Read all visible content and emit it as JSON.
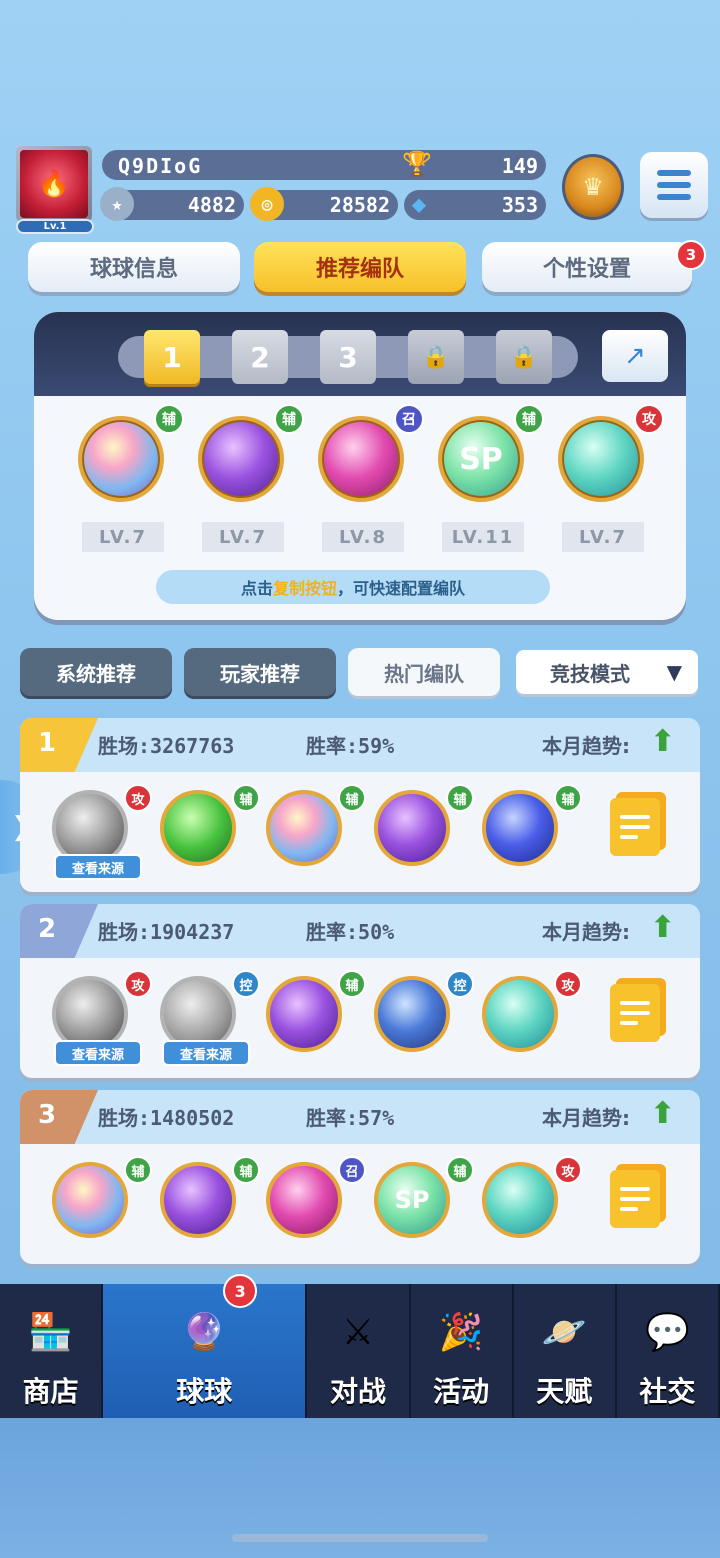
{
  "player": {
    "level": "Lv.1",
    "name": "Q9DIoG",
    "trophies": "149",
    "stars": "4882",
    "coins": "28582",
    "gems": "353"
  },
  "tabs": [
    {
      "label": "球球信息"
    },
    {
      "label": "推荐编队"
    },
    {
      "label": "个性设置",
      "badge": "3"
    }
  ],
  "team_panel": {
    "slots": [
      "1",
      "2",
      "3"
    ],
    "active_slot": "1",
    "balls": [
      {
        "tag": "辅",
        "level": "LV.7",
        "type": "fu"
      },
      {
        "tag": "辅",
        "level": "LV.7",
        "type": "fu"
      },
      {
        "tag": "召",
        "level": "LV.8",
        "type": "zhao"
      },
      {
        "tag": "辅",
        "level": "LV.11",
        "type": "fu",
        "glyph": "SP"
      },
      {
        "tag": "攻",
        "level": "LV.7",
        "type": "gong"
      }
    ],
    "tip_prefix": "点击",
    "tip_highlight": "复制按钮",
    "tip_suffix": "，可快速配置编队"
  },
  "filters": {
    "system": "系统推荐",
    "player": "玩家推荐",
    "hot": "热门编队",
    "mode": "竞技模式"
  },
  "rankings": [
    {
      "rank": "1",
      "wins": "胜场:3267763",
      "rate": "胜率:59%",
      "trend": "本月趋势:",
      "balls": [
        {
          "tag": "攻",
          "grey": true,
          "src": "查看来源"
        },
        {
          "tag": "辅"
        },
        {
          "tag": "辅"
        },
        {
          "tag": "辅"
        },
        {
          "tag": "辅"
        }
      ]
    },
    {
      "rank": "2",
      "wins": "胜场:1904237",
      "rate": "胜率:50%",
      "trend": "本月趋势:",
      "balls": [
        {
          "tag": "攻",
          "grey": true,
          "src": "查看来源"
        },
        {
          "tag": "控",
          "grey": true,
          "src": "查看来源"
        },
        {
          "tag": "辅"
        },
        {
          "tag": "控"
        },
        {
          "tag": "攻"
        }
      ]
    },
    {
      "rank": "3",
      "wins": "胜场:1480502",
      "rate": "胜率:57%",
      "trend": "本月趋势:",
      "balls": [
        {
          "tag": "辅"
        },
        {
          "tag": "辅"
        },
        {
          "tag": "召"
        },
        {
          "tag": "辅",
          "glyph": "SP"
        },
        {
          "tag": "攻"
        }
      ]
    }
  ],
  "nav": [
    {
      "label": "商店",
      "icon": "shop-icon"
    },
    {
      "label": "球球",
      "icon": "ball-icon",
      "badge": "3",
      "active": true
    },
    {
      "label": "对战",
      "icon": "swords-icon"
    },
    {
      "label": "活动",
      "icon": "party-icon"
    },
    {
      "label": "天赋",
      "icon": "planet-icon"
    },
    {
      "label": "社交",
      "icon": "chat-icon"
    }
  ],
  "colors": {
    "accent": "#f7c02a",
    "nav_active": "#2a76cc",
    "nav_bg": "#1f2a48"
  }
}
